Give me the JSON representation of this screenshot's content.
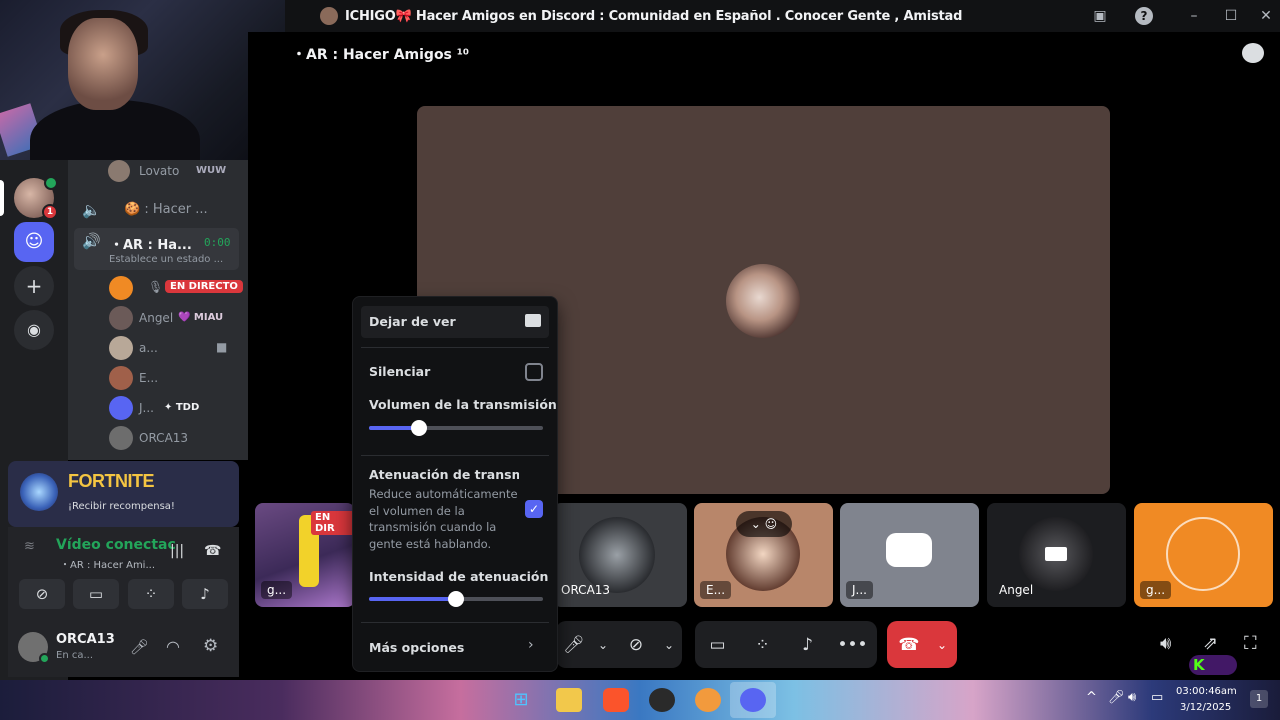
{
  "window": {
    "title": "ICHIGO🎀 Hacer Amigos en Discord : Comunidad en Español . Conocer Gente , Amistad , Socializar , Ha..."
  },
  "stage": {
    "channel_title": "・AR : Hacer Amigos ¹⁰"
  },
  "channels": {
    "top_user": {
      "name": "Lovato",
      "tag": "WUW"
    },
    "other_channel": "🍪 : Hacer ...",
    "active_channel": {
      "name": "・AR : Ha...",
      "timer": "0:00",
      "status": "Establece un estado ..."
    },
    "members": [
      {
        "name": "",
        "badge": "EN DIRECTO"
      },
      {
        "name": "Angel",
        "tag": "💜 MIAU"
      },
      {
        "name": "a..."
      },
      {
        "name": "E..."
      },
      {
        "name": "J...",
        "tag": "✦ TDD"
      },
      {
        "name": "ORCA13"
      }
    ]
  },
  "promo": {
    "game": "FORTNITE",
    "subtitle": "¡Recibir recompensa!"
  },
  "voice_panel": {
    "status": "Vídeo conectac",
    "channel": "・AR : Hacer Ami..."
  },
  "user_panel": {
    "name": "ORCA13",
    "status": "En ca..."
  },
  "guild_badges": {
    "badge_a": "1"
  },
  "tiles": [
    {
      "label": "g...",
      "badge": "EN DIR"
    },
    {
      "label": "ORCA13"
    },
    {
      "label": "E..."
    },
    {
      "label": "J..."
    },
    {
      "label": "Angel"
    },
    {
      "label": "g..."
    }
  ],
  "popup": {
    "stop_watching": "Dejar de ver",
    "mute": "Silenciar",
    "mute_checked": false,
    "volume_label": "Volumen de la transmisión",
    "volume_value": 0.29,
    "attenuation_title": "Atenuación de transmisi...",
    "attenuation_desc": "Reduce automáticamente el volumen de la transmisión cuando la gente está hablando.",
    "attenuation_checked": true,
    "intensity_label": "Intensidad de atenuación de ...",
    "intensity_value": 0.5,
    "more_options": "Más opciones"
  },
  "taskbar": {
    "time": "03:00:46am",
    "date": "3/12/2025",
    "notifications": "1"
  },
  "colors": {
    "accent": "#5865f2",
    "live_red": "#da373c",
    "online_green": "#23a55a",
    "hangup_red": "#da373c"
  }
}
